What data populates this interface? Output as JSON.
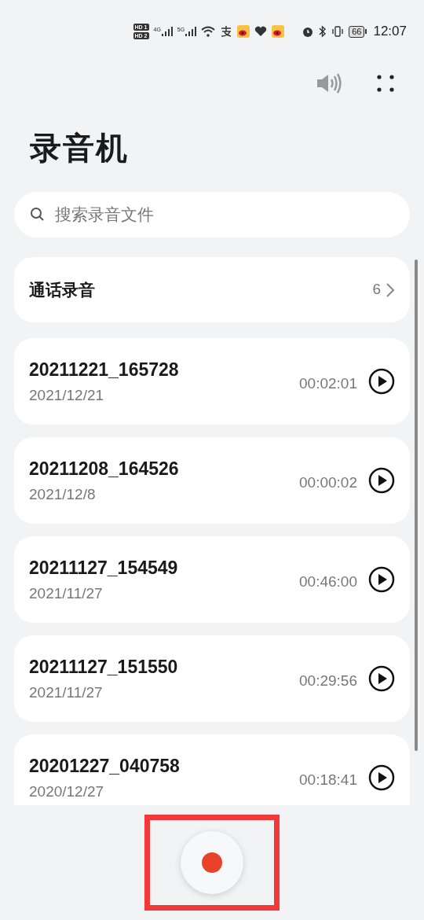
{
  "status_bar": {
    "sim_badges": [
      "HD 1",
      "HD 2"
    ],
    "networks": [
      "4G",
      "5G"
    ],
    "battery": "66",
    "time": "12:07"
  },
  "title": "录音机",
  "search": {
    "placeholder": "搜索录音文件"
  },
  "call_recordings": {
    "label": "通话录音",
    "count": "6"
  },
  "recordings": [
    {
      "name": "20211221_165728",
      "date": "2021/12/21",
      "duration": "00:02:01"
    },
    {
      "name": "20211208_164526",
      "date": "2021/12/8",
      "duration": "00:00:02"
    },
    {
      "name": "20211127_154549",
      "date": "2021/11/27",
      "duration": "00:46:00"
    },
    {
      "name": "20211127_151550",
      "date": "2021/11/27",
      "duration": "00:29:56"
    },
    {
      "name": "20201227_040758",
      "date": "2020/12/27",
      "duration": "00:18:41"
    }
  ]
}
